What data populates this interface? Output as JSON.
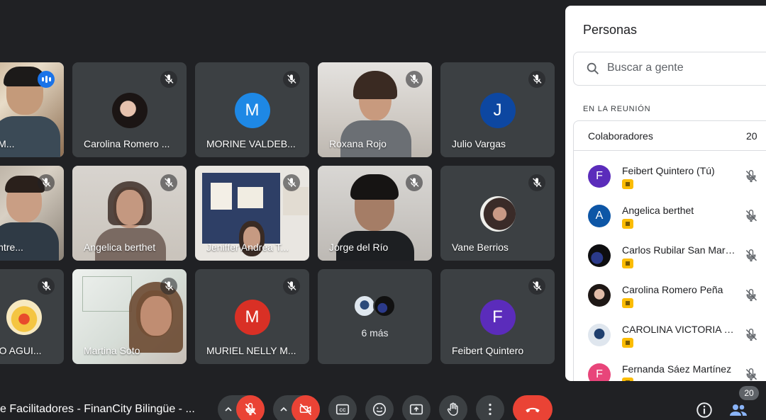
{
  "tiles": [
    {
      "name": "Rorales M..."
    },
    {
      "name": "Carolina Romero ..."
    },
    {
      "name": "MORINE VALDEB...",
      "initial": "M",
      "color": "#1e88e5"
    },
    {
      "name": "Roxana Rojo"
    },
    {
      "name": "Julio Vargas",
      "initial": "J",
      "color": "#0d47a1"
    },
    {
      "name": "Juan Contre..."
    },
    {
      "name": "Angelica berthet"
    },
    {
      "name": "Jeniffer Andrea T..."
    },
    {
      "name": "Jorge del Río"
    },
    {
      "name": "Vane Berrios"
    },
    {
      "name": "RICARDO AGUI..."
    },
    {
      "name": "Martina Soto"
    },
    {
      "name": "MURIEL NELLY M...",
      "initial": "M",
      "color": "#d93025"
    },
    {
      "more_label": "6 más"
    },
    {
      "name": "Feibert Quintero",
      "initial": "F",
      "color": "#5b2cbb"
    }
  ],
  "panel": {
    "title": "Personas",
    "search_placeholder": "Buscar a gente",
    "section_label": "EN LA REUNIÓN",
    "group_label": "Colaboradores",
    "group_count": "20",
    "people": [
      {
        "name": "Feibert Quintero (Tú)",
        "initial": "F",
        "color": "#5b2cbb"
      },
      {
        "name": "Angelica berthet",
        "initial": "A",
        "color": "#0d56a6"
      },
      {
        "name": "Carlos Rubilar San Martin",
        "initial": "",
        "color": "#1b2a4a"
      },
      {
        "name": "Carolina Romero Peña",
        "initial": "",
        "color": "#3b2d2a"
      },
      {
        "name": "CAROLINA VICTORIA C...",
        "initial": "",
        "color": "#c9d6e3"
      },
      {
        "name": "Fernanda Sáez Martínez",
        "initial": "F",
        "color": "#e8457a"
      }
    ]
  },
  "bottom": {
    "meeting_title": "e Facilitadores - FinanCity Bilingüe - ...",
    "people_count": "20"
  },
  "colors": {
    "accent": "#8ab4f8",
    "danger": "#ea4335",
    "background": "#202124"
  }
}
